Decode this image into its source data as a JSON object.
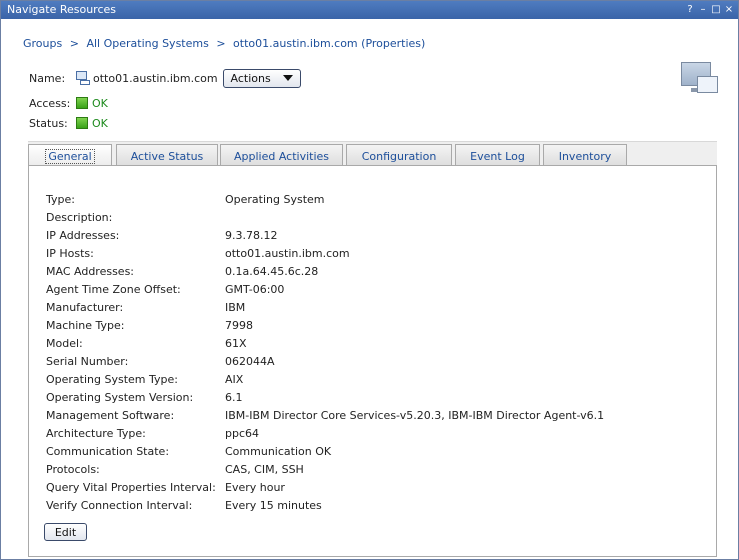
{
  "window": {
    "title": "Navigate Resources",
    "help": "?",
    "minimize": "–",
    "maximize": "□",
    "close": "×"
  },
  "breadcrumb": [
    "Groups",
    "All Operating Systems",
    "otto01.austin.ibm.com (Properties)"
  ],
  "breadcrumb_sep": ">",
  "resource": {
    "name_label": "Name:",
    "name": "otto01.austin.ibm.com",
    "actions_label": "Actions",
    "access_label": "Access:",
    "access_value": "OK",
    "status_label": "Status:",
    "status_value": "OK"
  },
  "tabs": [
    "General",
    "Active Status",
    "Applied Activities",
    "Configuration",
    "Event Log",
    "Inventory"
  ],
  "active_tab": "General",
  "properties": [
    {
      "label": "Type:",
      "value": "Operating System"
    },
    {
      "label": "Description:",
      "value": ""
    },
    {
      "label": "IP Addresses:",
      "value": "9.3.78.12"
    },
    {
      "label": "IP Hosts:",
      "value": "otto01.austin.ibm.com"
    },
    {
      "label": "MAC Addresses:",
      "value": "0.1a.64.45.6c.28"
    },
    {
      "label": "Agent Time Zone Offset:",
      "value": "GMT-06:00"
    },
    {
      "label": "Manufacturer:",
      "value": "IBM"
    },
    {
      "label": "Machine Type:",
      "value": "7998"
    },
    {
      "label": "Model:",
      "value": "61X"
    },
    {
      "label": "Serial Number:",
      "value": "062044A"
    },
    {
      "label": "Operating System Type:",
      "value": "AIX"
    },
    {
      "label": "Operating System Version:",
      "value": "6.1"
    },
    {
      "label": "Management Software:",
      "value": "IBM-IBM Director Core Services-v5.20.3, IBM-IBM Director Agent-v6.1"
    },
    {
      "label": "Architecture Type:",
      "value": "ppc64"
    },
    {
      "label": "Communication State:",
      "value": "Communication OK"
    },
    {
      "label": "Protocols:",
      "value": "CAS, CIM, SSH"
    },
    {
      "label": "Query Vital Properties Interval:",
      "value": "Every hour"
    },
    {
      "label": "Verify Connection Interval:",
      "value": "Every 15 minutes"
    }
  ],
  "edit_label": "Edit",
  "colors": {
    "titlebar": "#3a64a8",
    "link": "#1c4e9a",
    "ok": "#3aa21a"
  }
}
